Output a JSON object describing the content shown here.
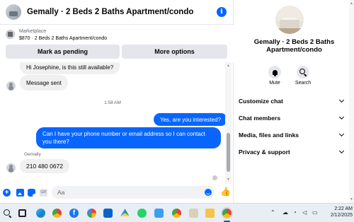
{
  "header": {
    "title": "Gemally · 2 Beds 2 Baths Apartment/condo",
    "info_icon": "info-icon"
  },
  "marketplace": {
    "label": "Marketplace",
    "description": "$870 · 2 Beds 2 Baths Apartment/condo",
    "pending_button": "Mark as pending",
    "more_button": "More options"
  },
  "messages": {
    "m1": "Hi Josephine, is this still available?",
    "m2": "Message sent",
    "timestamp": "1:58 AM",
    "m3": "Yes, are you interested?",
    "m4": "Can I have your phone number or email address so I can contact you there?",
    "sender": "Gemally",
    "m5": "210 480 0672"
  },
  "composer": {
    "placeholder": "Aa",
    "icons": [
      "plus-icon",
      "photo-icon",
      "sticker-icon",
      "gif-icon",
      "emoji-icon",
      "like-icon"
    ]
  },
  "details": {
    "title": "Gemally · 2 Beds 2 Baths Apartment/condo",
    "mute_label": "Mute",
    "search_label": "Search",
    "rows": [
      {
        "label": "Customize chat"
      },
      {
        "label": "Chat members"
      },
      {
        "label": "Media, files and links"
      },
      {
        "label": "Privacy & support"
      }
    ]
  },
  "taskbar": {
    "apps": [
      "search-icon",
      "task-view-icon",
      "edge-icon",
      "chrome-icon",
      "facebook-icon",
      "photos-icon",
      "outlook-icon",
      "drive-icon",
      "whatsapp-icon",
      "notepad-icon",
      "chrome-icon",
      "tool-icon",
      "file-explorer-icon",
      "chrome-icon"
    ],
    "time": "2:22 AM",
    "date": "2/12/2025"
  },
  "colors": {
    "accent": "#0866ff",
    "bubble_incoming": "#f0f0f0",
    "taskbar": "#e9eef5"
  }
}
